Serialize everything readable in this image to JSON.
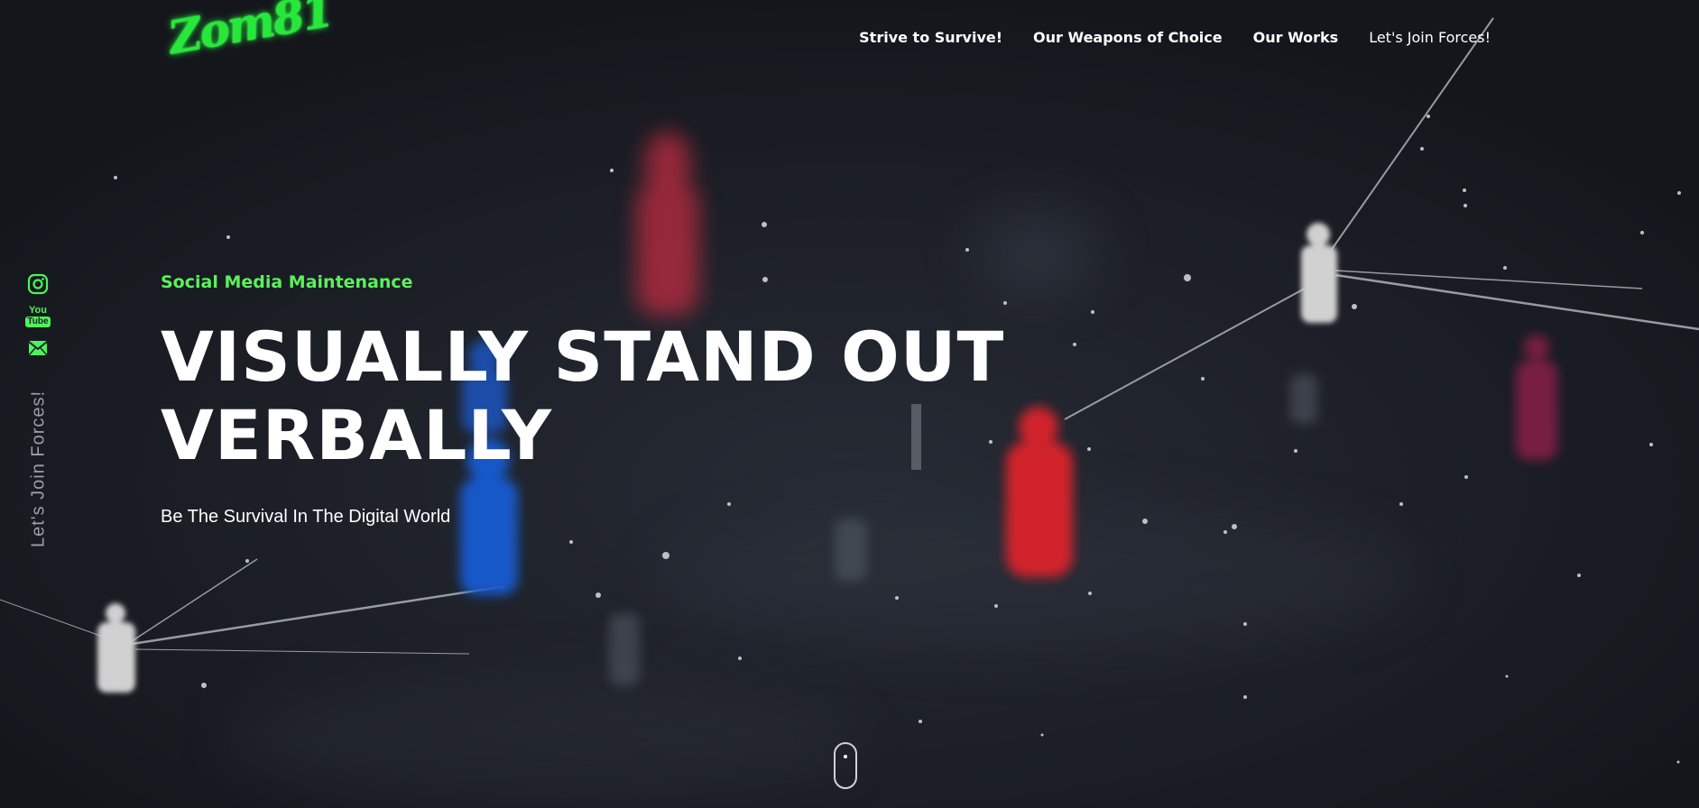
{
  "logo": {
    "text": "Zom81"
  },
  "nav": [
    {
      "label": "Strive to Survive!"
    },
    {
      "label": "Our Weapons of Choice"
    },
    {
      "label": "Our Works"
    },
    {
      "label": "Let's Join Forces!"
    }
  ],
  "social": {
    "icons": [
      "instagram-icon",
      "youtube-icon",
      "mail-icon"
    ],
    "youtube_you": "You",
    "youtube_tube": "Tube",
    "vertical_text": "Let's Join Forces!"
  },
  "hero": {
    "kicker": "Social Media Maintenance",
    "title_line1": "VISUALLY STAND OUT",
    "title_line2": "VERBALLY",
    "subtitle": "Be The Survival In The Digital World"
  },
  "colors": {
    "accent": "#27e83a",
    "background": "#1c1f27",
    "text": "#ffffff"
  }
}
